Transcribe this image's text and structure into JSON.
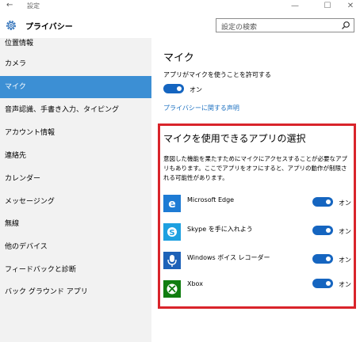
{
  "window": {
    "back_glyph": "←",
    "title": "設定",
    "controls": [
      "—",
      "☐",
      "✕"
    ]
  },
  "header": {
    "icon": "gear-icon",
    "title": "プライバシー",
    "search_placeholder": "設定の検索"
  },
  "sidebar": {
    "items": [
      {
        "label": "位置情報",
        "active": false
      },
      {
        "label": "カメラ",
        "active": false
      },
      {
        "label": "マイク",
        "active": true
      },
      {
        "label": "音声認識、手書き入力、タイピング",
        "active": false
      },
      {
        "label": "アカウント情報",
        "active": false
      },
      {
        "label": "連絡先",
        "active": false
      },
      {
        "label": "カレンダー",
        "active": false
      },
      {
        "label": "メッセージング",
        "active": false
      },
      {
        "label": "無線",
        "active": false
      },
      {
        "label": "他のデバイス",
        "active": false
      },
      {
        "label": "フィードバックと診断",
        "active": false
      },
      {
        "label": "バック グラウンド アプリ",
        "active": false
      }
    ]
  },
  "main": {
    "title": "マイク",
    "permission_label": "アプリがマイクを使うことを許可する",
    "permission_state": "オン",
    "privacy_link": "プライバシーに関する声明",
    "apps_section": {
      "title": "マイクを使用できるアプリの選択",
      "description": "意図した機能を果たすためにマイクにアクセスすることが必要なアプリもあります。ここでアプリをオフにすると、アプリの動作が制限される可能性があります。",
      "apps": [
        {
          "name": "Microsoft Edge",
          "icon": "edge-icon",
          "state": "オン",
          "color": "#1e7bd4"
        },
        {
          "name": "Skype を手に入れよう",
          "icon": "skype-icon",
          "state": "オン",
          "color": "#1ea0e0"
        },
        {
          "name": "Windows ボイス レコーダー",
          "icon": "microphone-icon",
          "state": "オン",
          "color": "#1e62b8"
        },
        {
          "name": "Xbox",
          "icon": "xbox-icon",
          "state": "オン",
          "color": "#117d10"
        }
      ]
    }
  },
  "colors": {
    "accent": "#1565c0",
    "sidebar_active": "#3c8fd4",
    "highlight_border": "#d9242b",
    "link": "#1a6fc0"
  }
}
